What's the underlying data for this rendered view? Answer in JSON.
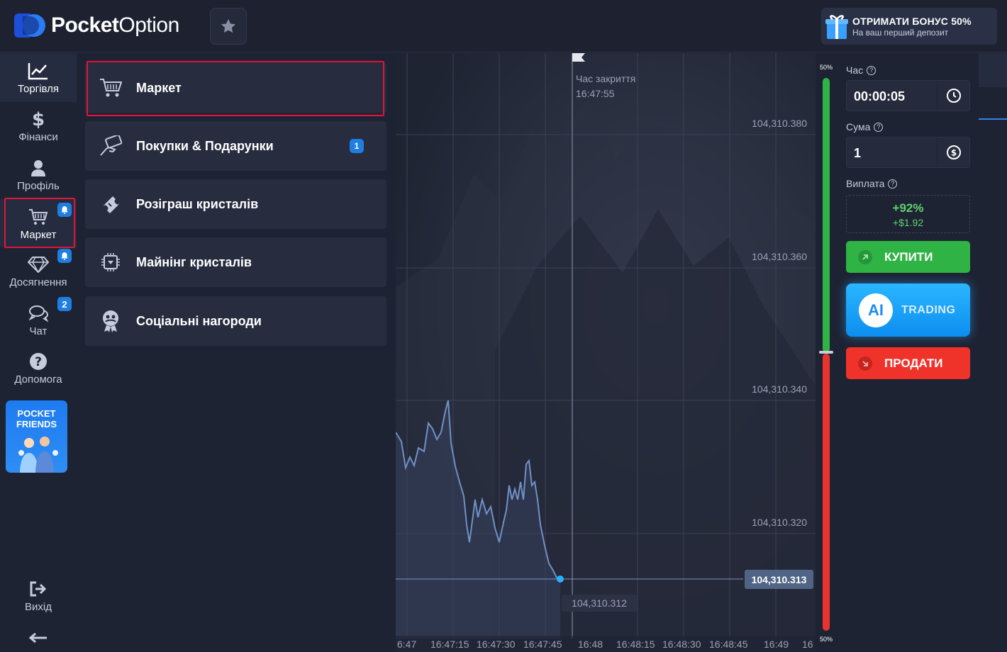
{
  "header": {
    "logo_bold": "Pocket",
    "logo_thin": "Option",
    "bonus_title": "ОТРИМАТИ БОНУС 50%",
    "bonus_subtitle": "На ваш перший депозит"
  },
  "nav": {
    "items": [
      {
        "label": "Торгівля",
        "icon": "chart-line-icon"
      },
      {
        "label": "Фінанси",
        "icon": "dollar-icon"
      },
      {
        "label": "Профіль",
        "icon": "user-icon"
      },
      {
        "label": "Маркет",
        "icon": "cart-icon"
      },
      {
        "label": "Досягнення",
        "icon": "diamond-icon"
      },
      {
        "label": "Чат",
        "icon": "chat-icon",
        "badge": "2"
      },
      {
        "label": "Допомога",
        "icon": "help-icon"
      }
    ],
    "pocket_friends": "POCKET FRIENDS",
    "logout": "Вихід"
  },
  "market": {
    "items": [
      {
        "label": "Маркет",
        "icon": "cart-icon"
      },
      {
        "label": "Покупки & Подарунки",
        "icon": "gift-card-icon",
        "badge": "1"
      },
      {
        "label": "Розіграш кристалів",
        "icon": "ticket-icon"
      },
      {
        "label": "Майнінг кристалів",
        "icon": "chip-icon"
      },
      {
        "label": "Соціальні нагороди",
        "icon": "award-icon"
      }
    ]
  },
  "chart": {
    "close_time_label": "Час закриття",
    "close_time": "16:47:55",
    "price_levels": [
      "104,310.380",
      "104,310.360",
      "104,310.340",
      "104,310.320"
    ],
    "current_price": "104,310.313",
    "low_price": "104,310.312",
    "x_ticks": [
      "6:47",
      "16:47:15",
      "16:47:30",
      "16:47:45",
      "16:48",
      "16:48:15",
      "16:48:30",
      "16:48:45",
      "16:49",
      "16"
    ]
  },
  "sentiment": {
    "top": "50%",
    "bottom": "50%",
    "up_color": "#2fb344",
    "down_color": "#e8342c"
  },
  "trade": {
    "time_label": "Час",
    "time_value": "00:00:05",
    "amount_label": "Сума",
    "amount_value": "1",
    "payout_label": "Виплата",
    "payout_percent": "+92%",
    "payout_amount": "+$1.92",
    "buy_label": "КУПИТИ",
    "ai_label": "AI",
    "ai_text": "TRADING",
    "sell_label": "ПРОДАТИ",
    "buy_color": "#2fb344",
    "sell_color": "#f0332a"
  }
}
